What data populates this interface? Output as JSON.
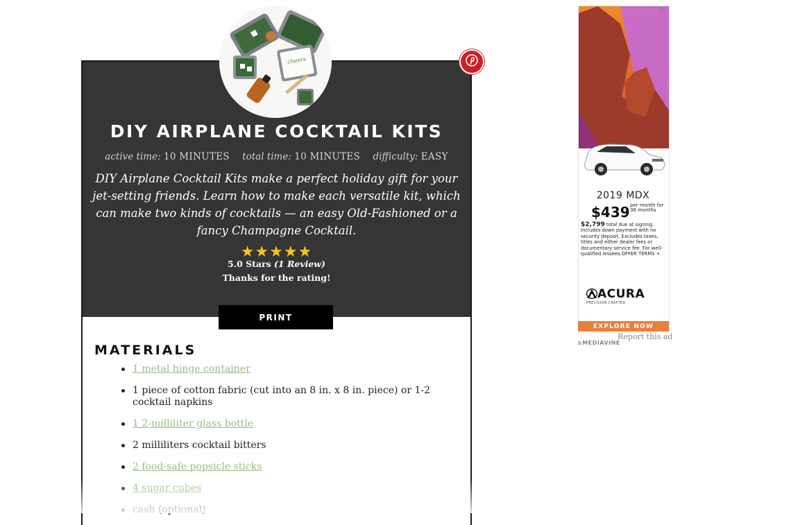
{
  "recipe": {
    "title": "DIY AIRPLANE COCKTAIL KITS",
    "meta": [
      {
        "key": "active time:",
        "value": "10 MINUTES"
      },
      {
        "key": "total time:",
        "value": "10 MINUTES"
      },
      {
        "key": "difficulty:",
        "value": "EASY"
      }
    ],
    "summary": "DIY Airplane Cocktail Kits make a perfect holiday gift for your jet-setting friends. Learn how to make each versatile kit, which can make two kinds of cocktails — an easy Old-Fashioned or a fancy Champagne Cocktail.",
    "stars": "★★★★★",
    "rating_value": "5.0 Stars",
    "rating_count": "(1 Review)",
    "rating_thanks": "Thanks for the rating!",
    "star_rating": 5,
    "print_label": "PRINT",
    "pin_icon": "pinterest-icon",
    "materials_heading": "MATERIALS",
    "materials": [
      {
        "text": "1 metal hinge container",
        "link": true
      },
      {
        "text": "1 piece of cotton fabric (cut into an 8 in. x 8 in. piece) or 1-2 cocktail napkins",
        "link": false
      },
      {
        "text": "1 2-milliliter glass bottle",
        "link": true
      },
      {
        "text": "2 milliliters cocktail bitters",
        "link": false
      },
      {
        "text": "2 food-safe popsicle sticks",
        "link": true
      },
      {
        "text": "4 sugar cubes",
        "link": true
      },
      {
        "text": "cash (optional)",
        "link": false
      }
    ]
  },
  "ad": {
    "model": "2019 MDX",
    "price": "$439",
    "price_terms": "per month for 36 months",
    "fine_print_lead": "$2,799",
    "fine_print": "total due at signing. Includes down payment with no security deposit. Excludes taxes, titles and either dealer fees or documentary service fee. For well-qualified lessees.OFFER TERMS +",
    "brand": "ACURA",
    "tagline": "PRECISION CRAFTED",
    "cta": "EXPLORE NOW",
    "report": "Report this ad",
    "network": "MEDIAVINE",
    "adchoices_icon": "adchoices-icon"
  },
  "colors": {
    "card_dark": "#353535",
    "link_green": "#9bbb86",
    "star_gold": "#f5c518",
    "pin_red": "#cb2027",
    "ad_cta_orange": "#e9803a"
  }
}
